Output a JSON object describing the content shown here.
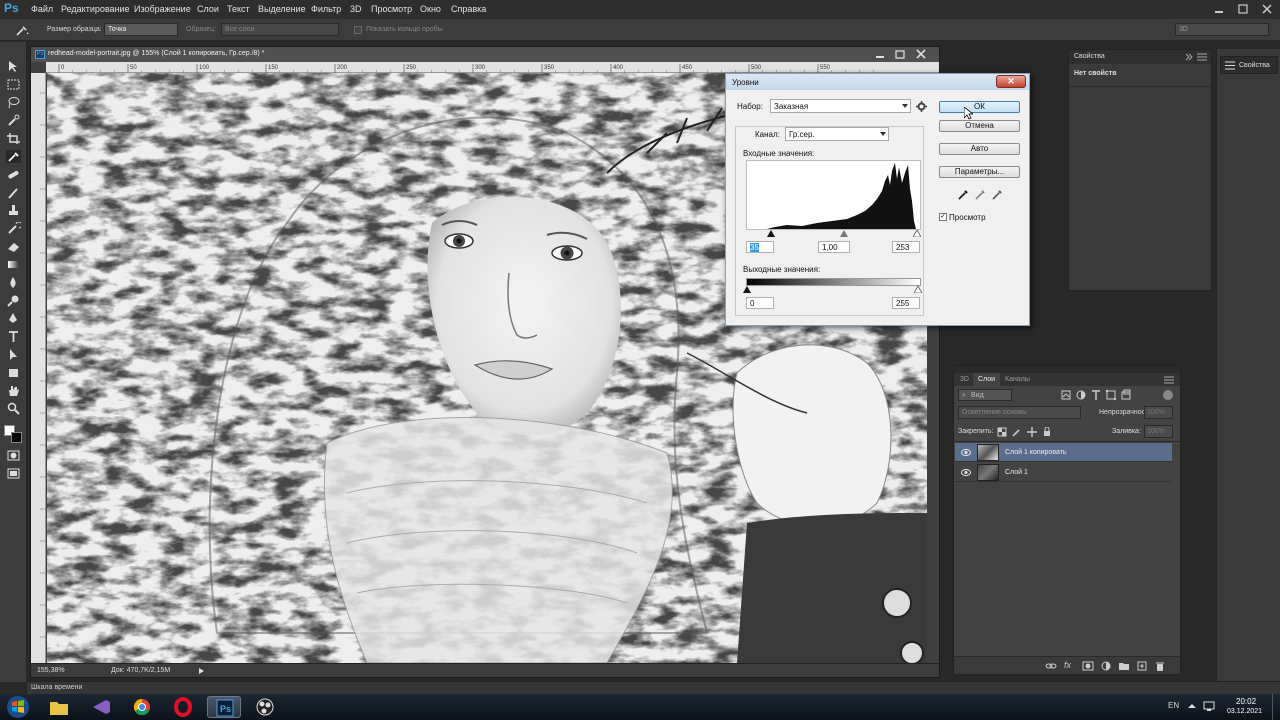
{
  "app": {
    "logo": "Ps",
    "menu": [
      "Файл",
      "Редактирование",
      "Изображение",
      "Слои",
      "Текст",
      "Выделение",
      "Фильтр",
      "3D",
      "Просмотр",
      "Окно",
      "Справка"
    ],
    "workspace": "3D"
  },
  "options_bar": {
    "sample_size_label": "Размер образца:",
    "sample_size_value": "Точка",
    "sample_label": "Образец:",
    "sample_value": "Все слои",
    "show_ring_label": "Показать кольцо пробы"
  },
  "document": {
    "title": "redhead-model-portrait.jpg @ 155% (Слой 1 копировать, Гр.сер./8) *",
    "ruler_ticks": [
      "0",
      "50",
      "100",
      "150",
      "200",
      "250",
      "300",
      "350",
      "400",
      "450",
      "500",
      "550"
    ],
    "zoom": "155,38%",
    "doc_size": "Док: 470,7K/2,15M"
  },
  "levels": {
    "title": "Уровни",
    "preset_label": "Набор:",
    "preset_value": "Заказная",
    "channel_label": "Канал:",
    "channel_value": "Гр.сер.",
    "input_label": "Входные значения:",
    "input_black": "35",
    "input_gamma": "1,00",
    "input_white": "253",
    "output_label": "Выходные значения:",
    "output_black": "0",
    "output_white": "255",
    "ok_label": "ОК",
    "cancel_label": "Отмена",
    "auto_label": "Авто",
    "options_label": "Параметры...",
    "preview_label": "Просмотр",
    "preview_checked": true
  },
  "properties_panel": {
    "title": "Свойства",
    "empty_text": "Нет свойств",
    "strip_label": "Свойства"
  },
  "layers_panel": {
    "tabs": [
      "3D",
      "Слои",
      "Каналы"
    ],
    "active_tab": "Слои",
    "filter_placeholder": "Вид",
    "blend_mode": "Осветление основы",
    "opacity_label": "Непрозрачность:",
    "opacity_value": "100%",
    "lock_label": "Закрепить:",
    "fill_label": "Заливка:",
    "fill_value": "100%",
    "layers": [
      {
        "name": "Слой 1 копировать",
        "selected": true
      },
      {
        "name": "Слой 1",
        "selected": false
      }
    ]
  },
  "timeline": {
    "label": "Шкала времени"
  },
  "taskbar": {
    "lang": "EN",
    "time": "20:02",
    "date": "03.12.2021"
  },
  "colors": {
    "ps_bg": "#282828",
    "panel": "#3c3c3c",
    "selected_layer": "#5a6e8c",
    "ok_button": "#bfe0f6"
  }
}
